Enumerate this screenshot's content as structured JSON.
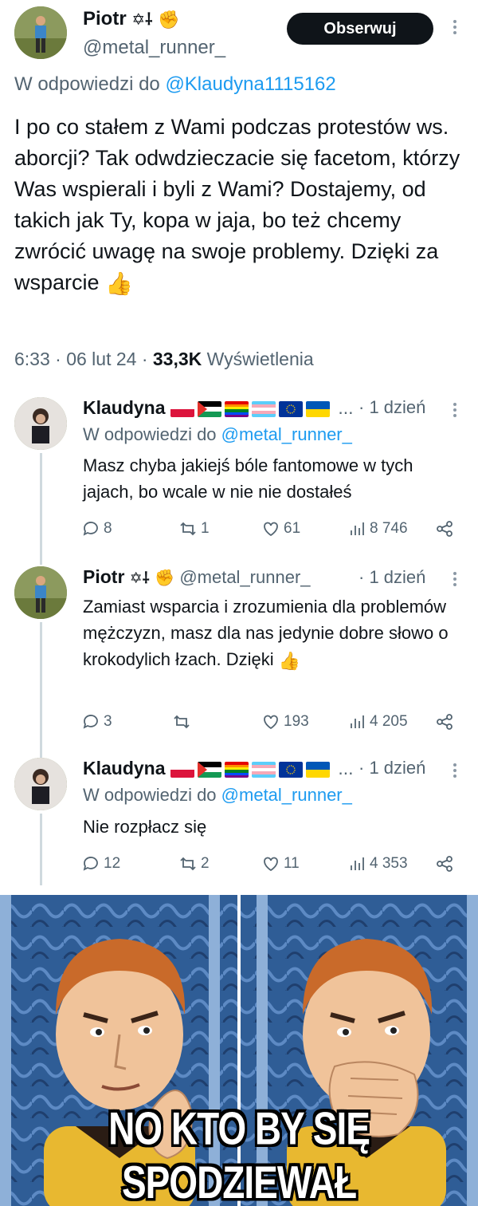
{
  "main_tweet": {
    "author_name": "Piotr",
    "author_suffix": "✡⸸",
    "handle": "@metal_runner_",
    "follow_label": "Obserwuj",
    "reply_prefix": "W odpowiedzi do",
    "reply_to": "@Klaudyna1115162",
    "text": "I po co stałem z Wami podczas protestów ws. aborcji? Tak odwdzieczacie się facetom, którzy Was wspierali i byli z Wami? Dostajemy, od takich jak Ty, kopa w jaja, bo też chcemy zwrócić uwagę na swoje problemy. Dzięki za wsparcie",
    "time": "6:33 · 06 lut 24 ·",
    "views_count": "33,3K",
    "views_label": "Wyświetlenia"
  },
  "replies": [
    {
      "author_name": "Klaudyna",
      "flags_ellipsis": "...",
      "time": "· 1 dzień",
      "reply_prefix": "W odpowiedzi do",
      "reply_to": "@metal_runner_",
      "text": "Masz chyba jakiejś bóle fantomowe w tych jajach, bo wcale w nie nie dostałeś",
      "replies": "8",
      "retweets": "1",
      "likes": "61",
      "views": "8 746"
    },
    {
      "author_name": "Piotr",
      "author_suffix": "✡⸸",
      "handle": "@metal_runner_",
      "time": "· 1 dzień",
      "text": "Zamiast wsparcia i zrozumienia dla problemów mężczyzn, masz dla nas jedynie dobre słowo o krokodylich łzach. Dzięki",
      "replies": "3",
      "retweets": "",
      "likes": "193",
      "views": "4 205"
    },
    {
      "author_name": "Klaudyna",
      "flags_ellipsis": "...",
      "time": "· 1 dzień",
      "reply_prefix": "W odpowiedzi do",
      "reply_to": "@metal_runner_",
      "text": "Nie rozpłacz się",
      "replies": "12",
      "retweets": "2",
      "likes": "11",
      "views": "4 353"
    }
  ],
  "meme": {
    "caption": "NO KTO BY SIĘ SPODZIEWAŁ"
  },
  "colors": {
    "link_blue": "#1d9bf0",
    "muted_gray": "#536471",
    "follow_bg": "#0f1419"
  }
}
